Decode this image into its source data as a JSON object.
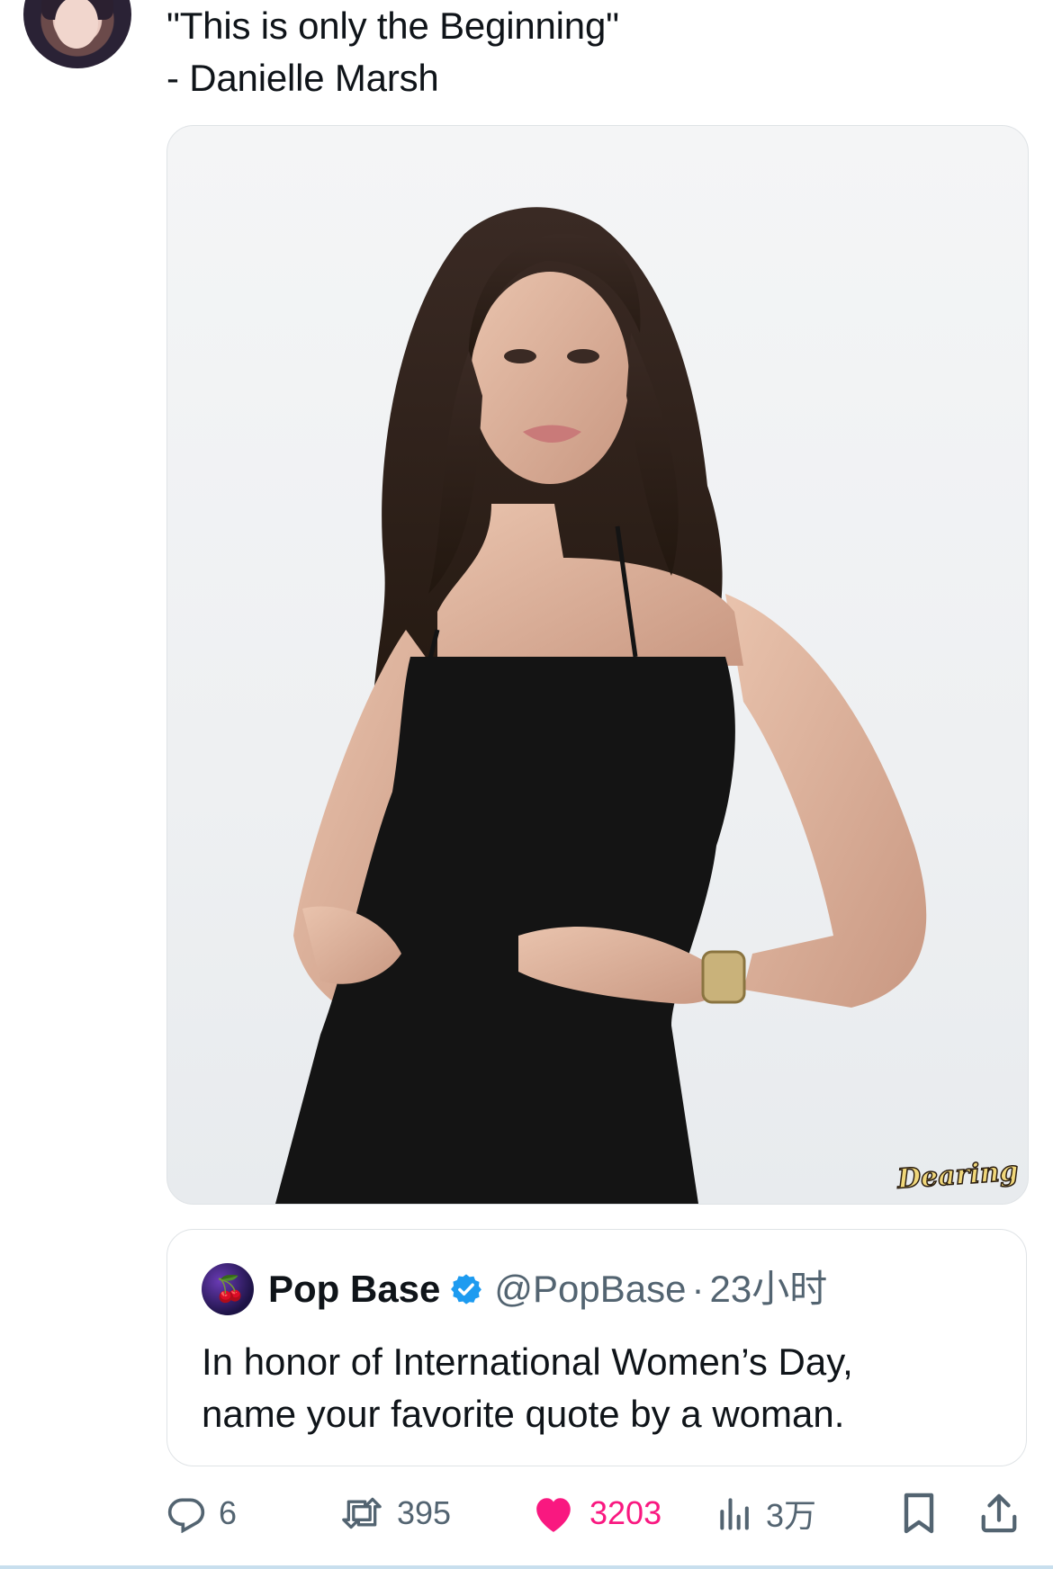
{
  "tweet": {
    "text_line1": "\"This is only the Beginning\"",
    "text_line2": "- Danielle Marsh"
  },
  "photo": {
    "watermark": "Dearing"
  },
  "quoted_tweet": {
    "name": "Pop Base",
    "handle": "@PopBase",
    "separator": "·",
    "time": "23小时",
    "body_line1": "In honor of International Women’s Day,",
    "body_line2": "name your favorite quote by a woman."
  },
  "actions": {
    "replies": "6",
    "retweets": "395",
    "likes": "3203",
    "views": "3万"
  },
  "colors": {
    "text": "#0f1419",
    "secondary": "#536471",
    "like": "#f91880",
    "verified": "#1d9bf0",
    "border": "#dfe3e6"
  },
  "icons": [
    "reply-icon",
    "retweet-icon",
    "like-icon",
    "views-icon",
    "bookmark-icon",
    "share-icon",
    "verified-badge-icon"
  ]
}
